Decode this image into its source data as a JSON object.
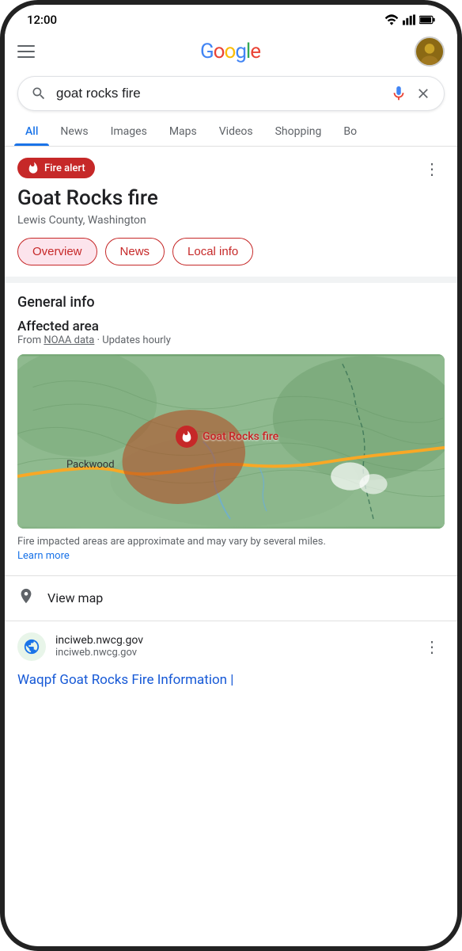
{
  "status": {
    "time": "12:00",
    "wifi": true,
    "signal": true,
    "battery": true
  },
  "header": {
    "google_logo_letters": [
      "G",
      "o",
      "o",
      "g",
      "l",
      "e"
    ],
    "menu_label": "Menu",
    "avatar_label": "User avatar"
  },
  "search": {
    "query": "goat rocks fire",
    "placeholder": "Search",
    "mic_label": "Voice search",
    "clear_label": "Clear"
  },
  "tabs": {
    "items": [
      {
        "label": "All",
        "active": true
      },
      {
        "label": "News",
        "active": false
      },
      {
        "label": "Images",
        "active": false
      },
      {
        "label": "Maps",
        "active": false
      },
      {
        "label": "Videos",
        "active": false
      },
      {
        "label": "Shopping",
        "active": false
      },
      {
        "label": "Bo",
        "active": false
      }
    ]
  },
  "fire_card": {
    "badge_text": "Fire alert",
    "title": "Goat Rocks fire",
    "subtitle": "Lewis County, Washington",
    "more_options_label": "More options",
    "pill_tabs": [
      {
        "label": "Overview",
        "active": true
      },
      {
        "label": "News",
        "active": false
      },
      {
        "label": "Local info",
        "active": false
      }
    ]
  },
  "general_info": {
    "section_title": "General info",
    "affected_area_title": "Affected area",
    "source_text": "From",
    "source_link": "NOAA data",
    "source_suffix": "· Updates hourly",
    "fire_marker_label": "Goat Rocks fire",
    "packwood_label": "Packwood",
    "map_caption": "Fire impacted areas are approximate and may vary by several miles.",
    "learn_more_label": "Learn more"
  },
  "view_map": {
    "label": "View map"
  },
  "website": {
    "domain": "inciweb.nwcg.gov",
    "domain_sub": "inciweb.nwcg.gov",
    "link_title": "Waqpf Goat Rocks Fire Information |",
    "more_options_label": "More options"
  }
}
